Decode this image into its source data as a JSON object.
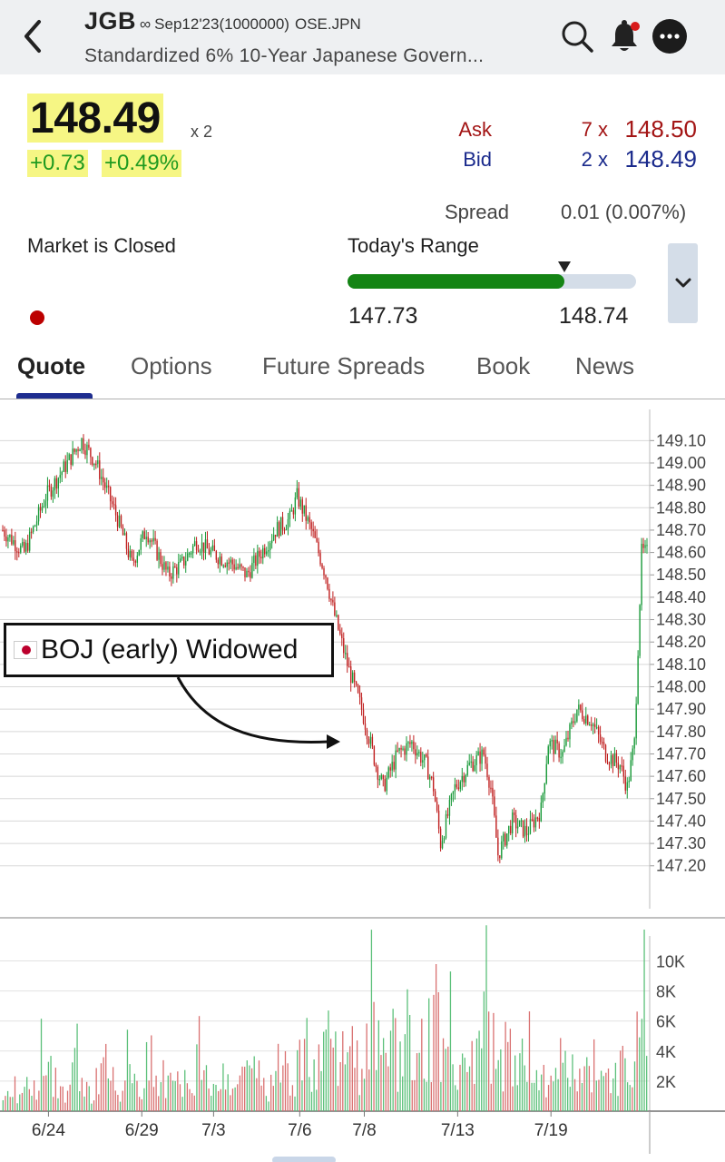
{
  "header": {
    "symbol": "JGB",
    "infinity": "∞",
    "contract": "Sep12'23(1000000)",
    "exchange": "OSE.JPN",
    "subtitle": "Standardized 6% 10-Year Japanese Govern...",
    "icons": [
      "back-chevron-icon",
      "search-icon",
      "bell-icon",
      "more-icon"
    ]
  },
  "quote": {
    "last": "148.49",
    "last_qty": "x 2",
    "change": "+0.73",
    "change_pct": "+0.49%",
    "ask_label": "Ask",
    "ask_qty": "7 x",
    "ask_price": "148.50",
    "bid_label": "Bid",
    "bid_qty": "2 x",
    "bid_price": "148.49",
    "spread_label": "Spread",
    "spread_value": "0.01 (0.007%)",
    "market_status": "Market is Closed",
    "range_label": "Today's Range",
    "range_low": "147.73",
    "range_high": "148.74",
    "range_position": 0.75,
    "colors": {
      "ask": "#a31515",
      "bid": "#1a2a8c",
      "up": "#1f9a1f",
      "highlight": "#f6f684"
    }
  },
  "tabs": [
    {
      "label": "Quote",
      "active": true
    },
    {
      "label": "Options",
      "active": false
    },
    {
      "label": "Future Spreads",
      "active": false
    },
    {
      "label": "Book",
      "active": false
    },
    {
      "label": "News",
      "active": false
    }
  ],
  "annotation": {
    "text": "BOJ (early) Widowed",
    "flag": "japan-flag-icon"
  },
  "chart_data": {
    "type": "candlestick",
    "price_axis": {
      "ticks": [
        "149.10",
        "149.00",
        "148.90",
        "148.80",
        "148.70",
        "148.60",
        "148.50",
        "148.40",
        "148.30",
        "148.20",
        "148.10",
        "148.00",
        "147.90",
        "147.80",
        "147.70",
        "147.60",
        "147.50",
        "147.40",
        "147.30",
        "147.20"
      ],
      "ylim": [
        147.13,
        149.15
      ]
    },
    "volume_axis": {
      "ticks": [
        "10K",
        "8K",
        "6K",
        "4K",
        "2K"
      ],
      "ylim": [
        0,
        11300
      ]
    },
    "x_ticks": [
      {
        "label": "6/24",
        "bar": 6
      },
      {
        "label": "6/29",
        "bar": 19
      },
      {
        "label": "7/3",
        "bar": 29
      },
      {
        "label": "7/6",
        "bar": 41
      },
      {
        "label": "7/8",
        "bar": 50
      },
      {
        "label": "7/13",
        "bar": 63
      },
      {
        "label": "7/19",
        "bar": 76
      }
    ],
    "up_color": "#1a9a3a",
    "down_color": "#c02020",
    "close_path": [
      [
        0,
        148.7
      ],
      [
        3,
        148.6
      ],
      [
        6,
        148.85
      ],
      [
        9,
        149.0
      ],
      [
        11,
        149.1
      ],
      [
        13,
        149.0
      ],
      [
        16,
        148.75
      ],
      [
        18,
        148.55
      ],
      [
        20,
        148.7
      ],
      [
        23,
        148.5
      ],
      [
        25,
        148.55
      ],
      [
        27,
        148.65
      ],
      [
        29,
        148.6
      ],
      [
        32,
        148.55
      ],
      [
        34,
        148.5
      ],
      [
        36,
        148.6
      ],
      [
        38,
        148.7
      ],
      [
        40,
        148.75
      ],
      [
        41,
        148.85
      ],
      [
        43,
        148.7
      ],
      [
        45,
        148.5
      ],
      [
        46,
        148.35
      ],
      [
        48,
        148.1
      ],
      [
        50,
        147.9
      ],
      [
        52,
        147.65
      ],
      [
        53,
        147.55
      ],
      [
        55,
        147.7
      ],
      [
        57,
        147.75
      ],
      [
        59,
        147.65
      ],
      [
        60,
        147.55
      ],
      [
        61,
        147.3
      ],
      [
        63,
        147.55
      ],
      [
        65,
        147.65
      ],
      [
        67,
        147.7
      ],
      [
        68,
        147.55
      ],
      [
        69,
        147.25
      ],
      [
        71,
        147.4
      ],
      [
        73,
        147.35
      ],
      [
        75,
        147.45
      ],
      [
        76,
        147.75
      ],
      [
        78,
        147.7
      ],
      [
        80,
        147.9
      ],
      [
        82,
        147.85
      ],
      [
        84,
        147.7
      ],
      [
        86,
        147.65
      ],
      [
        87,
        147.55
      ],
      [
        88,
        147.75
      ],
      [
        89,
        148.6
      ]
    ],
    "volume_profile": [
      2,
      3,
      2,
      4,
      3,
      5,
      6,
      3,
      2,
      4,
      5,
      3,
      2,
      4,
      6,
      3,
      2,
      5,
      4,
      3,
      6,
      2,
      3,
      5,
      4,
      3,
      2,
      6,
      5,
      3,
      4,
      2,
      3,
      5,
      4,
      6,
      3,
      2,
      4,
      5,
      3,
      6,
      8,
      4,
      7,
      10,
      5,
      6,
      9,
      4,
      7,
      10,
      5,
      6,
      8,
      4,
      9,
      5,
      6,
      7,
      11,
      6,
      8,
      5,
      7,
      4,
      9,
      11,
      6,
      5,
      7,
      4,
      5,
      6,
      4,
      3,
      5,
      6,
      4,
      5,
      3,
      4,
      5,
      6,
      4,
      3,
      5,
      4,
      6,
      10
    ]
  }
}
